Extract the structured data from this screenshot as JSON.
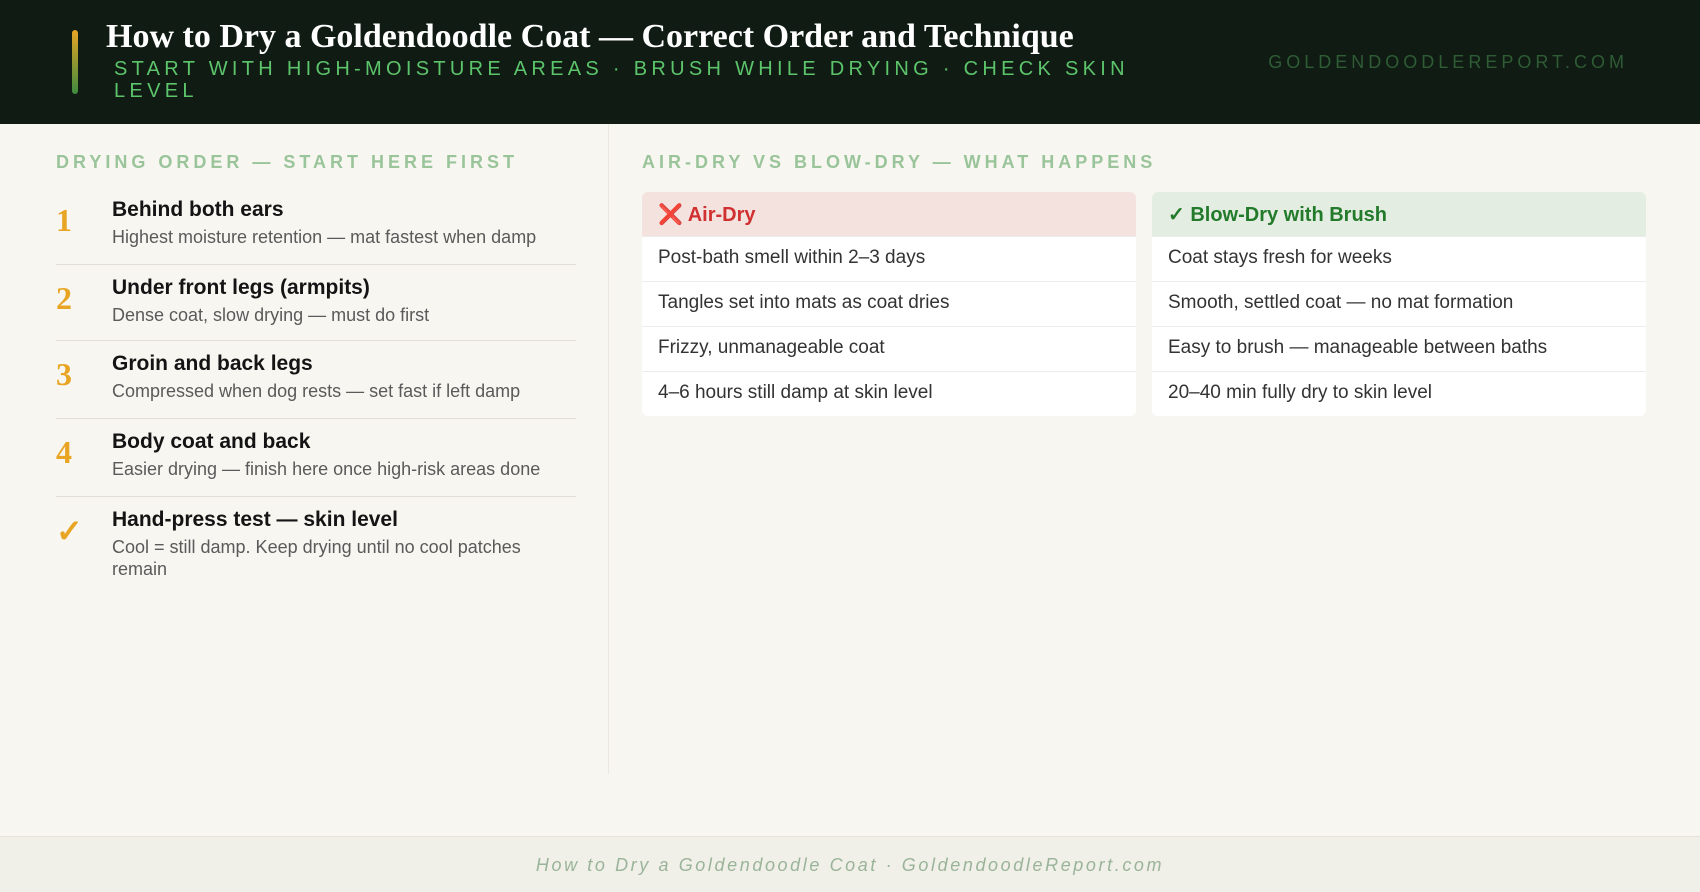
{
  "header": {
    "title": "How to Dry a Goldendoodle Coat — Correct Order and Technique",
    "subtitle": "START WITH HIGH-MOISTURE AREAS · BRUSH WHILE DRYING · CHECK SKIN LEVEL",
    "site": "GOLDENDOODLEREPORT.COM"
  },
  "order": {
    "label": "DRYING ORDER — START HERE FIRST",
    "steps": [
      {
        "marker": "1",
        "title": "Behind both ears",
        "desc": "Highest moisture retention — mat fastest when damp"
      },
      {
        "marker": "2",
        "title": "Under front legs (armpits)",
        "desc": "Dense coat, slow drying — must do first"
      },
      {
        "marker": "3",
        "title": "Groin and back legs",
        "desc": "Compressed when dog rests — set fast if left damp"
      },
      {
        "marker": "4",
        "title": "Body coat and back",
        "desc": "Easier drying — finish here once high-risk areas done"
      },
      {
        "marker": "✓",
        "title": "Hand-press test — skin level",
        "desc": "Cool = still damp. Keep drying until no cool patches remain"
      }
    ]
  },
  "compare": {
    "label": "AIR-DRY VS BLOW-DRY — WHAT HAPPENS",
    "air": {
      "icon": "❌",
      "title": "Air-Dry",
      "rows": [
        "Post-bath smell within 2–3 days",
        "Tangles set into mats as coat dries",
        "Frizzy, unmanageable coat",
        "4–6 hours still damp at skin level"
      ]
    },
    "blow": {
      "icon": "✓",
      "title": "Blow-Dry with Brush",
      "rows": [
        "Coat stays fresh for weeks",
        "Smooth, settled coat — no mat formation",
        "Easy to brush — manageable between baths",
        "20–40 min fully dry to skin level"
      ]
    }
  },
  "footer": {
    "text": "How to Dry a Goldendoodle Coat · GoldendoodleReport.com"
  }
}
